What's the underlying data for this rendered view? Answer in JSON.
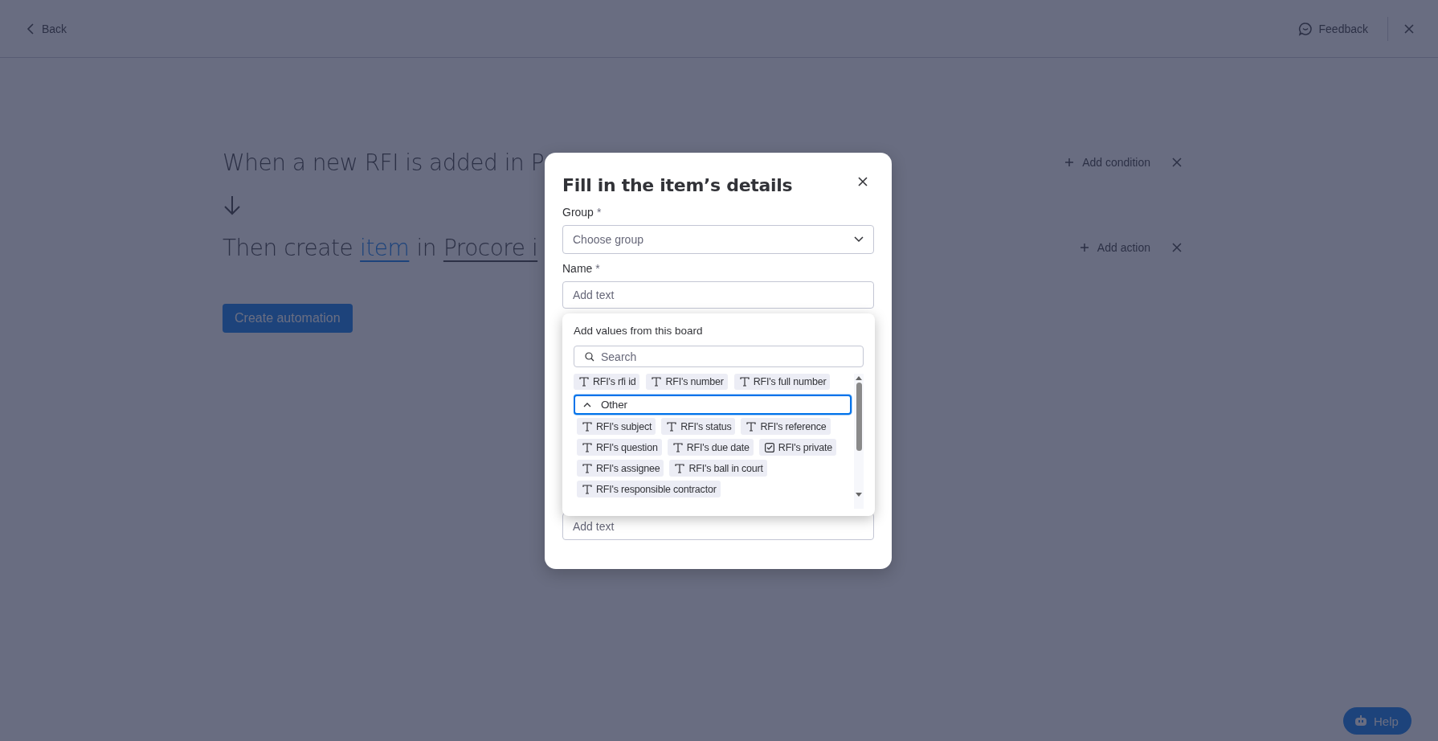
{
  "top_bar": {
    "back": "Back",
    "feedback": "Feedback"
  },
  "recipe": {
    "trigger": "When a new RFI is added in P",
    "action_parts": [
      {
        "kind": "plain",
        "text": "Then create"
      },
      {
        "kind": "link",
        "text": "item"
      },
      {
        "kind": "plain",
        "text": "in"
      },
      {
        "kind": "field",
        "text": "Procore i"
      }
    ],
    "add_condition": "Add condition",
    "add_action": "Add action",
    "create_button": "Create automation"
  },
  "modal": {
    "title": "Fill in the item’s details",
    "fields": [
      {
        "kind": "select",
        "label": "Group",
        "required_mark": "*",
        "placeholder": "Choose group"
      },
      {
        "kind": "text",
        "label": "Name",
        "required_mark": "*",
        "placeholder": "Add text"
      },
      {
        "kind": "text",
        "placeholder": "Add text"
      }
    ]
  },
  "values_menu": {
    "heading": "Add values from this board",
    "search_placeholder": "Search",
    "chips": [
      {
        "kind": "text",
        "label": "RFI's rfi id"
      },
      {
        "kind": "text",
        "label": "RFI's number"
      },
      {
        "kind": "text",
        "label": "RFI's full number"
      }
    ],
    "groups": [
      {
        "label": "Other",
        "expanded": true,
        "focused": true,
        "chips": [
          {
            "kind": "text",
            "label": "RFI's subject"
          },
          {
            "kind": "text",
            "label": "RFI's status"
          },
          {
            "kind": "text",
            "label": "RFI's reference"
          },
          {
            "kind": "text",
            "label": "RFI's question"
          },
          {
            "kind": "text",
            "label": "RFI's due date"
          },
          {
            "kind": "checkbox",
            "label": "RFI's private"
          },
          {
            "kind": "text",
            "label": "RFI's assignee"
          },
          {
            "kind": "text",
            "label": "RFI's ball in court"
          },
          {
            "kind": "text",
            "label": "RFI's responsible contractor"
          }
        ]
      }
    ]
  },
  "help": "Help"
}
